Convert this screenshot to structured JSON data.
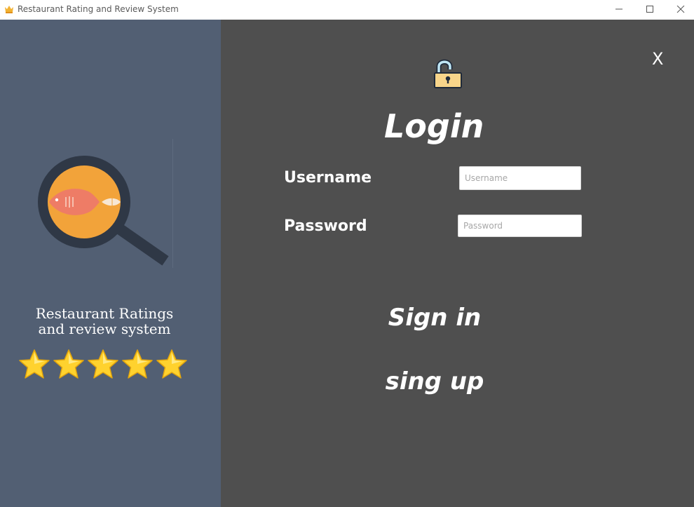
{
  "window": {
    "title": "Restaurant Rating and Review System",
    "controls": [
      "minimize",
      "maximize",
      "close"
    ]
  },
  "left_panel": {
    "logo": "magnifier-fish-icon",
    "brand_line1": "Restaurant Ratings",
    "brand_line2": "and review system",
    "rating_stars": 5
  },
  "login": {
    "close_label": "X",
    "lock_icon": "unlocked-padlock-icon",
    "title": "Login",
    "username_label": "Username",
    "username_placeholder": "Username",
    "password_label": "Password",
    "password_placeholder": "Password",
    "signin_label": "Sign in",
    "signup_label": "sing up"
  },
  "colors": {
    "left_panel_bg": "#525f73",
    "right_panel_bg": "#4f4f4f",
    "text": "#ffffff",
    "accent_orange": "#f2a33a",
    "star_yellow": "#ffd22e"
  }
}
